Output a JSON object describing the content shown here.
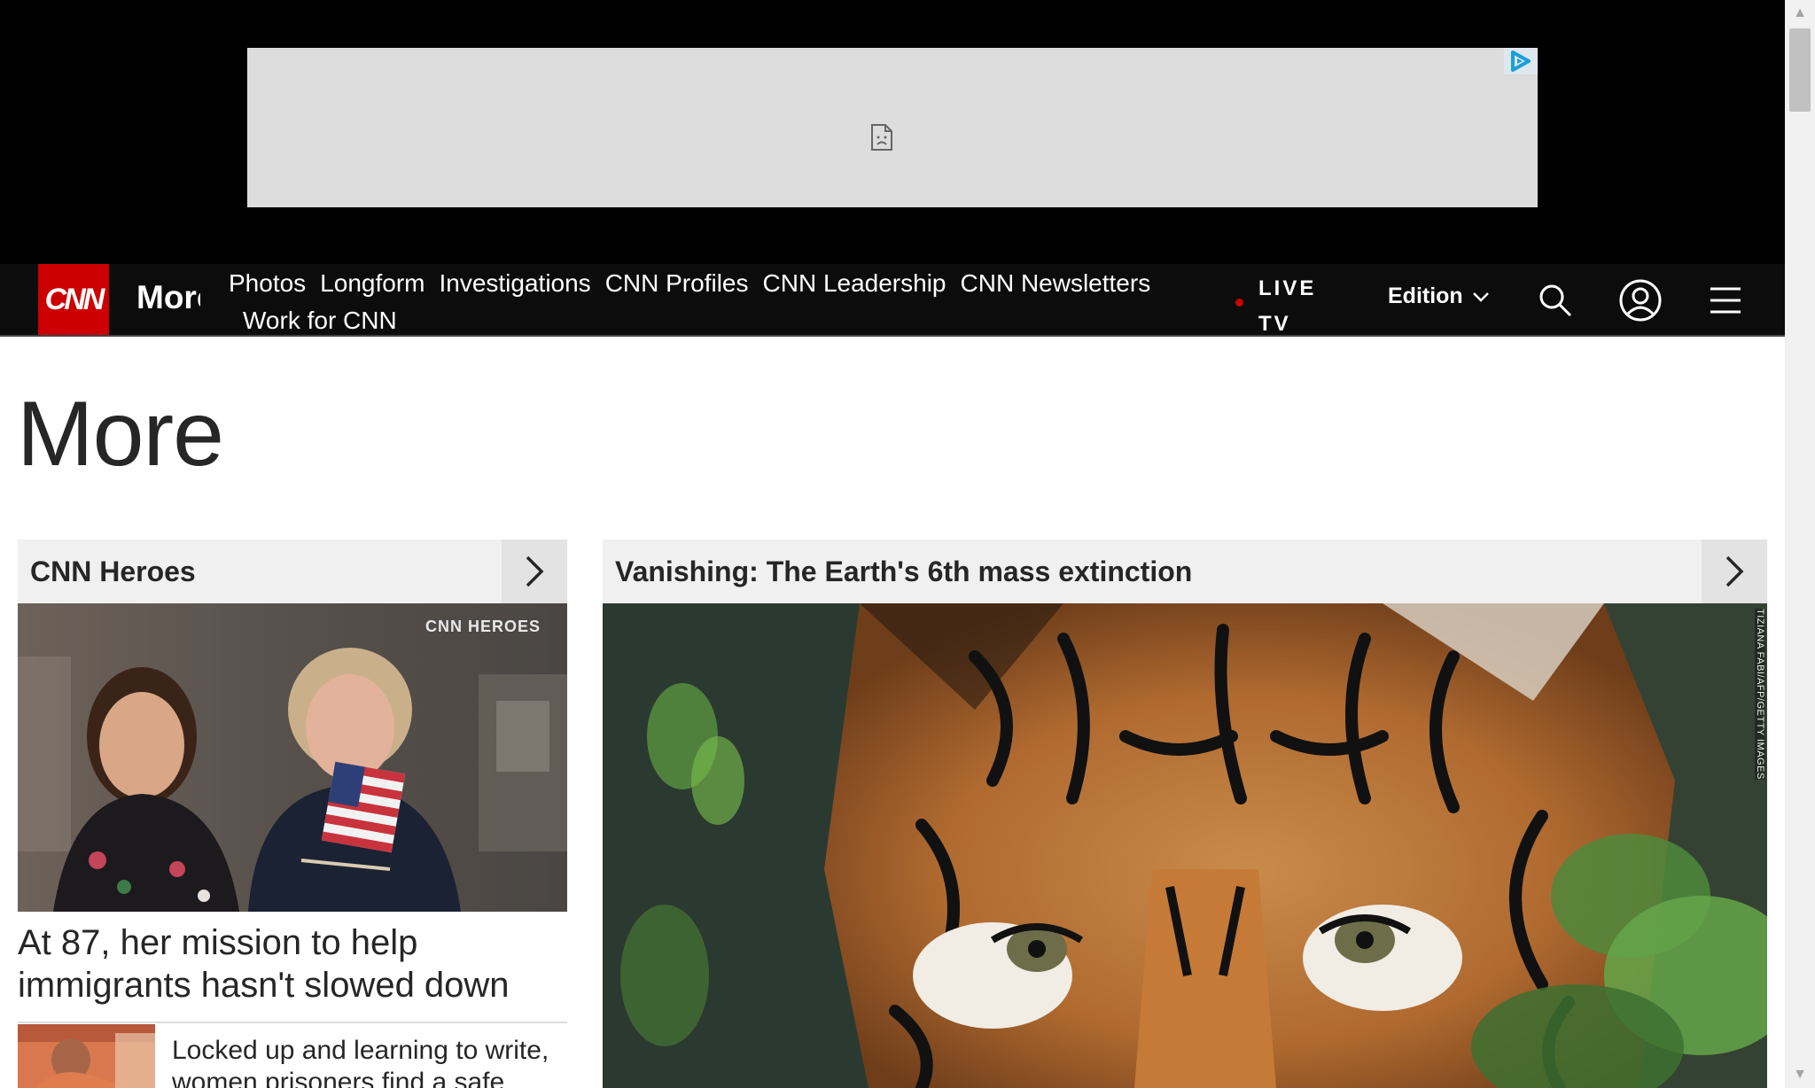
{
  "nav": {
    "logo_text": "CNN",
    "section_name": "More",
    "links_row1": [
      "Photos",
      "Longform",
      "Investigations",
      "CNN Profiles",
      "CNN Leadership",
      "CNN Newsletters"
    ],
    "links_row2": [
      "Work for CNN"
    ],
    "live_tv": "LIVE TV",
    "edition": "Edition",
    "icons": [
      "search-icon",
      "account-icon",
      "menu-icon"
    ]
  },
  "page": {
    "title": "More"
  },
  "heroes": {
    "header": "CNN Heroes",
    "watermark": "CNN HEROES",
    "headline": "At 87, her mission to help immigrants hasn't slowed down",
    "secondary": "Locked up and learning to write, women prisoners find a safe"
  },
  "vanishing": {
    "header": "Vanishing: The Earth's 6th mass extinction",
    "credit": "TIZIANA FABI/AFP/GETTY IMAGES"
  },
  "colors": {
    "brand_red": "#cc0000",
    "nav_bg": "#0c0c0c",
    "ad_bg": "#dddddd"
  }
}
